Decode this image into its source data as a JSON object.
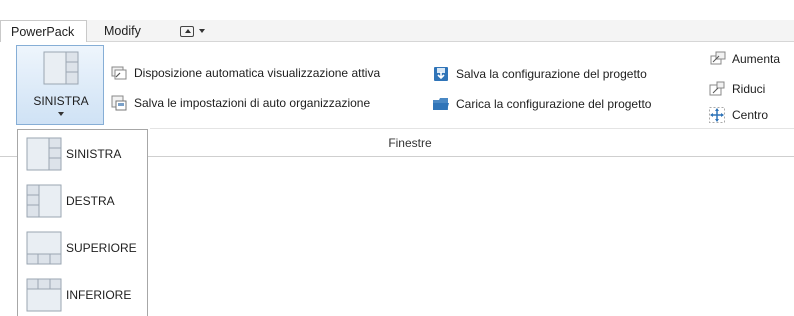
{
  "tabs": [
    {
      "label": "PowerPack"
    },
    {
      "label": "Modify"
    }
  ],
  "ribbon": {
    "group_label": "Finestre",
    "layout_button": {
      "label": "SINISTRA",
      "icon": "panel-left-icon"
    },
    "commands": [
      {
        "label": "Disposizione automatica  visualizzazione attiva",
        "icon": "auto-arrange-icon"
      },
      {
        "label": "Salva le impostazioni  di auto organizzazione",
        "icon": "save-settings-icon"
      },
      {
        "label": "Salva la configurazione  del progetto",
        "icon": "save-config-icon"
      },
      {
        "label": "Carica la configurazione  del progetto",
        "icon": "load-config-icon"
      },
      {
        "label": "Aumenta",
        "icon": "enlarge-icon"
      },
      {
        "label": "Riduci",
        "icon": "reduce-icon"
      },
      {
        "label": "Centro",
        "icon": "center-icon"
      }
    ]
  },
  "dropdown": {
    "items": [
      {
        "label": "SINISTRA",
        "icon": "panel-left-icon"
      },
      {
        "label": "DESTRA",
        "icon": "panel-right-icon"
      },
      {
        "label": "SUPERIORE",
        "icon": "panel-top-icon"
      },
      {
        "label": "INFERIORE",
        "icon": "panel-bottom-icon"
      }
    ]
  },
  "colors": {
    "selected_button_bg": "#cfe2f5",
    "selected_button_border": "#86aed6",
    "icon_blue": "#2f74b8"
  }
}
